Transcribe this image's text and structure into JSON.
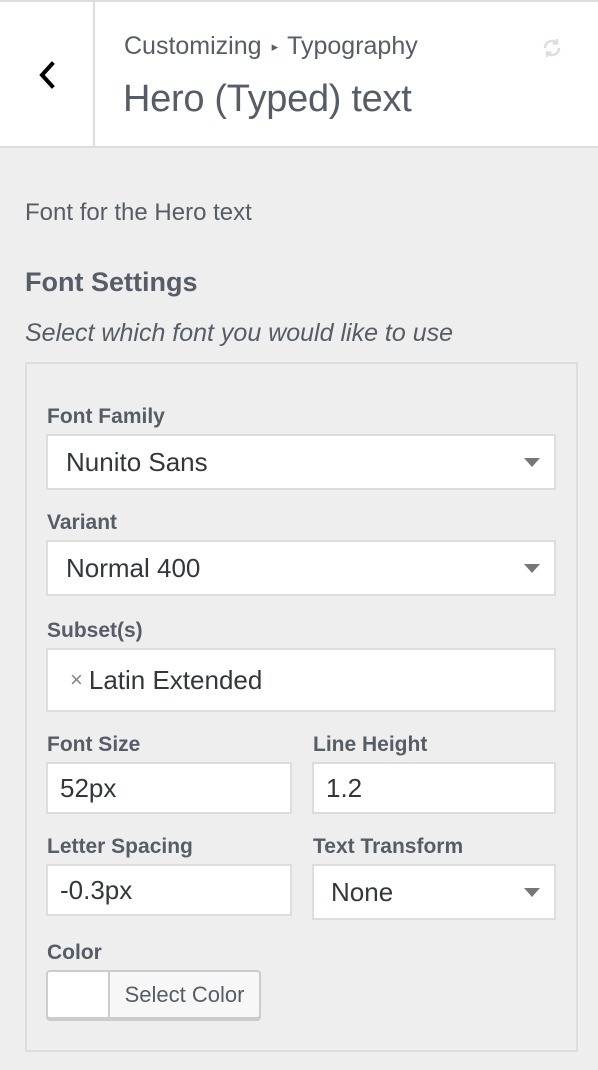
{
  "header": {
    "breadcrumb_root": "Customizing",
    "breadcrumb_sep": "▸",
    "breadcrumb_current": "Typography",
    "section_title": "Hero (Typed) text"
  },
  "control": {
    "description": "Font for the Hero text",
    "title": "Font Settings",
    "subtitle": "Select which font you would like to use"
  },
  "fields": {
    "font_family": {
      "label": "Font Family",
      "value": "Nunito Sans"
    },
    "variant": {
      "label": "Variant",
      "value": "Normal 400"
    },
    "subsets": {
      "label": "Subset(s)",
      "tag_remove": "×",
      "tag": "Latin Extended"
    },
    "font_size": {
      "label": "Font Size",
      "value": "52px"
    },
    "line_height": {
      "label": "Line Height",
      "value": "1.2"
    },
    "letter_spacing": {
      "label": "Letter Spacing",
      "value": "-0.3px"
    },
    "text_transform": {
      "label": "Text Transform",
      "value": "None"
    },
    "color": {
      "label": "Color",
      "button_label": "Select Color",
      "swatch": "#ffffff"
    }
  },
  "icons": {
    "back": "chevron-left-icon",
    "refresh": "refresh-icon",
    "dropdown": "caret-down-icon"
  }
}
